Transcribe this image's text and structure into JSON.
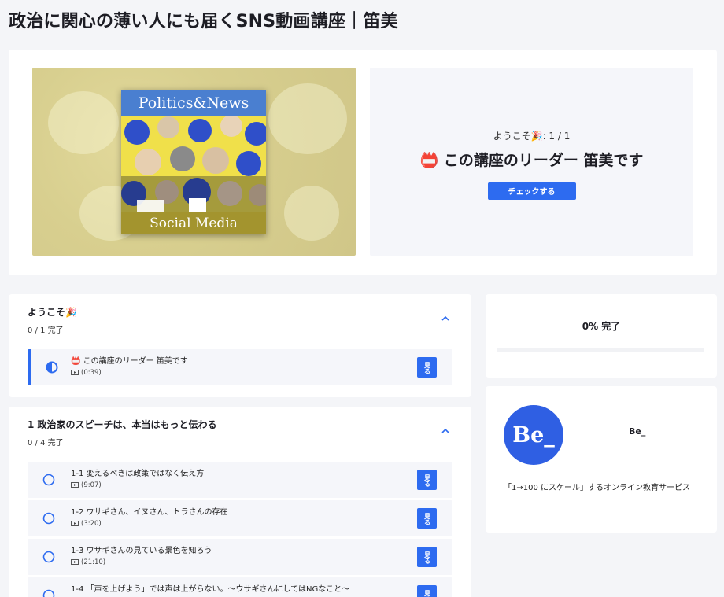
{
  "page": {
    "title": "政治に関心の薄い人にも届くSNS動画講座｜笛美"
  },
  "hero": {
    "cover_top": "Politics&News",
    "cover_bottom": "Social Media",
    "welcome_count": "ようこそ🎉: 1 / 1",
    "welcome_lesson": "📛 この講座のリーダー 笛美です",
    "check_button": "チェックする"
  },
  "sections": [
    {
      "title": "ようこそ🎉",
      "progress": "0 / 1 完了",
      "lessons": [
        {
          "title": "📛 この講座のリーダー 笛美です",
          "duration": "(0:39)",
          "status": "in-progress"
        }
      ]
    },
    {
      "title": "1 政治家のスピーチは、本当はもっと伝わる",
      "progress": "0 / 4 完了",
      "lessons": [
        {
          "title": "1-1 変えるべきは政策ではなく伝え方",
          "duration": "(9:07)",
          "status": "not-started"
        },
        {
          "title": "1-2 ウサギさん、イヌさん、トラさんの存在",
          "duration": "(3:20)",
          "status": "not-started"
        },
        {
          "title": "1-3 ウサギさんの見ている景色を知ろう",
          "duration": "(21:10)",
          "status": "not-started"
        },
        {
          "title": "1-4 「声を上げよう」では声は上がらない。〜ウサギさんにしてはNGなこと〜",
          "duration": "",
          "status": "not-started"
        }
      ]
    }
  ],
  "watch_label": "見る",
  "progress_card": {
    "label": "0% 完了",
    "percent": 0
  },
  "author": {
    "avatar_text": "Be_",
    "name": "Be_",
    "description": "「1→100 にスケール」するオンライン教育サービス"
  },
  "colors": {
    "accent": "#2d6bf0",
    "cover_blue": "#4a7fd0",
    "cover_olive": "#a3942e"
  }
}
